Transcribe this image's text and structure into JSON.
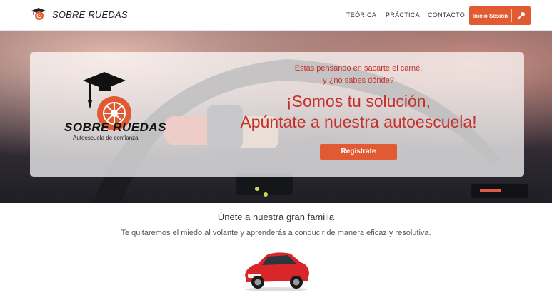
{
  "brand": {
    "name": "SOBRE RUEDAS"
  },
  "nav": {
    "links": [
      "TEÓRICA",
      "PRÁCTICA",
      "CONTACTO"
    ],
    "login_label": "Inicio Sesión"
  },
  "hero": {
    "logo_title": "SOBRE RUEDAS",
    "logo_subtitle": "Autoescuela de confianza",
    "question_line1": "Estas pensando en sacarte el carné,",
    "question_line2": "y ¿no sabes dónde?",
    "headline_line1": "¡Somos tu solución,",
    "headline_line2": "Apúntate a nuestra autoescuela!",
    "register_label": "Regístrate"
  },
  "section": {
    "title": "Únete a nuestra gran familia",
    "subtitle": "Te quitaremos el miedo al volante y aprenderás a conducir de manera eficaz y resolutiva."
  },
  "colors": {
    "accent": "#e15a32",
    "headline": "#c6322b"
  }
}
